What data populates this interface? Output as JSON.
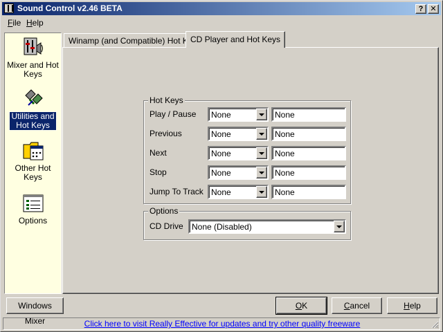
{
  "window": {
    "title": "Sound Control v2.46 BETA",
    "help_btn": "?",
    "close_btn": "✕"
  },
  "menu": [
    {
      "key": "F",
      "rest": "ile"
    },
    {
      "key": "H",
      "rest": "elp"
    }
  ],
  "sidebar": {
    "items": [
      {
        "line1": "Mixer and Hot",
        "line2": "Keys",
        "icon": "mixer-icon",
        "selected": false
      },
      {
        "line1": "Utilities and",
        "line2": "Hot Keys",
        "icon": "utilities-icon",
        "selected": true
      },
      {
        "line1": "Other Hot",
        "line2": "Keys",
        "icon": "other-hotkeys-icon",
        "selected": false
      },
      {
        "line1": "Options",
        "line2": "",
        "icon": "options-icon",
        "selected": false
      }
    ]
  },
  "tabs": [
    {
      "label": "Winamp (and Compatible) Hot Keys",
      "active": false
    },
    {
      "label": "CD Player and Hot Keys",
      "active": true
    }
  ],
  "hotkeys": {
    "group_label": "Hot Keys",
    "rows": [
      {
        "label": "Play / Pause",
        "modifier": "None",
        "key": "None"
      },
      {
        "label": "Previous",
        "modifier": "None",
        "key": "None"
      },
      {
        "label": "Next",
        "modifier": "None",
        "key": "None"
      },
      {
        "label": "Stop",
        "modifier": "None",
        "key": "None"
      },
      {
        "label": "Jump To Track",
        "modifier": "None",
        "key": "None"
      }
    ]
  },
  "options": {
    "group_label": "Options",
    "cd_drive_label": "CD Drive",
    "cd_drive_value": "None (Disabled)"
  },
  "buttons": {
    "windows_mixer": "Windows Mixer",
    "ok_key": "O",
    "ok_rest": "K",
    "cancel_pre": "",
    "cancel_key": "C",
    "cancel_rest": "ancel",
    "help_key": "H",
    "help_rest": "elp"
  },
  "status": {
    "link_text": "Click here to visit Really Effective for updates and try other quality freeware"
  },
  "colors": {
    "titlebar_start": "#0a246a",
    "titlebar_end": "#a6caf0",
    "sidebar_bg": "#ffffe1",
    "link": "#0000ff"
  }
}
